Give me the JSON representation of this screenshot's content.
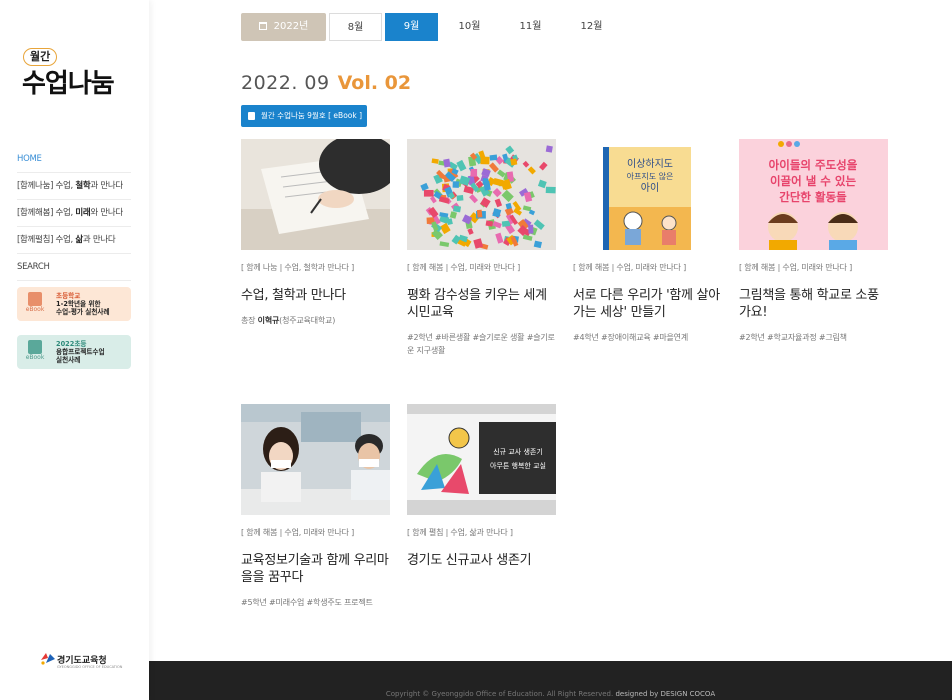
{
  "sidebar": {
    "logo_badge": "월간",
    "logo_main": "수업나눔",
    "nav": [
      {
        "label": "HOME"
      },
      {
        "pre": "[함께나눔] 수업, ",
        "bold": "철학",
        "post": "과 만나다"
      },
      {
        "pre": "[함께해봄] 수업, ",
        "bold": "미래",
        "post": "와 만나다"
      },
      {
        "pre": "[함께펼침] 수업, ",
        "bold": "삶",
        "post": "과 만나다"
      },
      {
        "label": "SEARCH"
      }
    ],
    "promos": [
      {
        "caption": "eBook",
        "line1": "초등학교",
        "line2": "1-2학년을 위한",
        "line3": "수업-평가 실천사례"
      },
      {
        "caption": "eBook",
        "line1": "2022초등",
        "line2": "융합프로젝트수업",
        "line3": "실천사례"
      }
    ],
    "footer_logo": "경기도교육청",
    "footer_logo_sub": "GYEONGGIDO OFFICE OF EDUCATION"
  },
  "tabs": {
    "year": "2022년",
    "months": [
      "8월",
      "9월",
      "10월",
      "11월",
      "12월"
    ],
    "active": "9월"
  },
  "issue": {
    "date": "2022. 09",
    "vol": "Vol. 02",
    "ebook_label": "월간 수업나눔 9월호 [ eBook ]"
  },
  "cards": [
    {
      "category": "[ 함께 나눔 | 수업, 철학과 만나다 ]",
      "title": "수업, 철학과 만나다",
      "meta_pre": "총장 ",
      "meta_bold": "이혁규",
      "meta_post": "(청주교육대학교)"
    },
    {
      "category": "[ 함께 해봄 | 수업, 미래와 만나다 ]",
      "title": "평화 감수성을 키우는 세계시민교육",
      "meta": "#2학년 #바른생활 #슬기로운 생활 #슬기로운 지구생활"
    },
    {
      "category": "[ 함께 해봄 | 수업, 미래와 만나다 ]",
      "title": "서로 다른 우리가 '함께 살아가는 세상' 만들기",
      "meta": "#4학년 #장애이해교육 #마을연계",
      "book_text_1": "이상하지도",
      "book_text_2": "아프지도 않은",
      "book_text_3": "아이"
    },
    {
      "category": "[ 함께 해봄 | 수업, 미래와 만나다 ]",
      "title": "그림책을 통해 학교로 소풍가요!",
      "meta": "#2학년 #학교자율과정 #그림책",
      "poster_1": "아이들의 주도성을",
      "poster_2": "이끌어 낼 수 있는",
      "poster_3": "간단한 활동들"
    },
    {
      "category": "[ 함께 해봄 | 수업, 미래와 만나다 ]",
      "title": "교육정보기술과 함께 우리마을을 꿈꾸다",
      "meta": "#5학년 #미래수업 #학생주도 프로젝트"
    },
    {
      "category": "[ 함께 펼침 | 수업, 삶과 만나다 ]",
      "title": "경기도 신규교사 생존기",
      "meta": "",
      "thumb_line1": "신규 교사 생존기",
      "thumb_line2": "아무튼 행복한 교실"
    }
  ],
  "footer": {
    "copyright": "Copyright © Gyeonggido Office of Education. All Right Reserved.",
    "designer": "designed by DESIGN COCOA"
  },
  "colors": {
    "accent_blue": "#1a83cc",
    "vol_orange": "#e9963a",
    "year_tab": "#cfc5b6",
    "footer_bg": "#222222"
  }
}
